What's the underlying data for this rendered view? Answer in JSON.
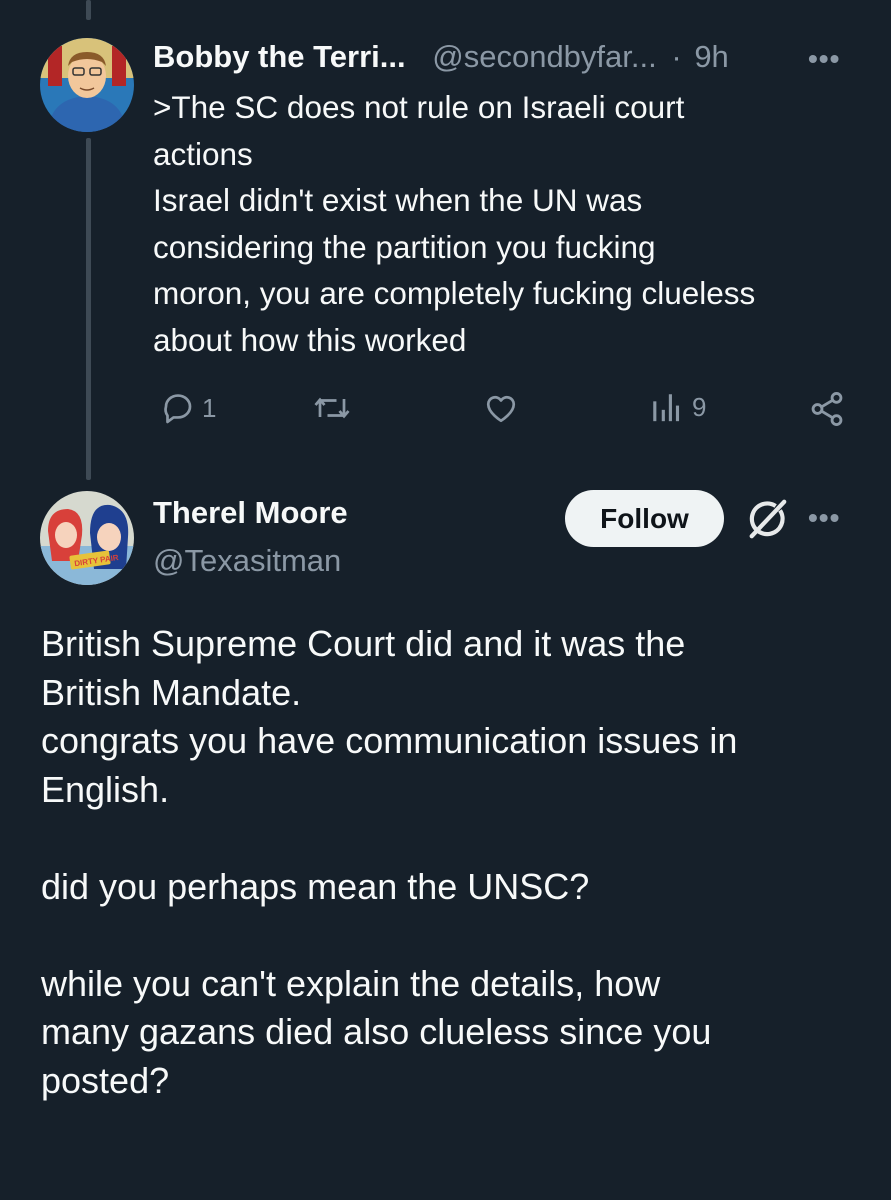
{
  "tweets": [
    {
      "display_name": "Bobby the Terri...",
      "handle": "@secondbyfar...",
      "separator": "·",
      "time": "9h",
      "more_label": "•••",
      "text": ">The SC does not rule on Israeli court\nactions\nIsrael didn't exist when the UN was\nconsidering the partition you fucking\nmoron, you are completely fucking clueless\nabout how this worked",
      "avatar_icon": "cartoon-character-avatar",
      "actions": {
        "reply_count": "1",
        "retweet_count": "",
        "like_count": "",
        "views_count": "9"
      }
    },
    {
      "display_name": "Therel Moore",
      "handle": "@Texasitman",
      "more_label": "•••",
      "follow_label": "Follow",
      "avatar_icon": "anime-girls-avatar",
      "avatar_caption": "DIRTY PAIR",
      "paragraphs": [
        "British Supreme Court did and it was the\nBritish Mandate.\ncongrats you have communication issues in\nEnglish.",
        "did you perhaps mean the UNSC?",
        "while you can't explain the details, how\nmany gazans died also clueless since you\nposted?"
      ]
    }
  ],
  "colors": {
    "background": "#16202a",
    "text_primary": "#f7f9f9",
    "text_secondary": "#8b98a5",
    "thread_line": "#3e4a55",
    "follow_bg": "#eff3f4"
  }
}
